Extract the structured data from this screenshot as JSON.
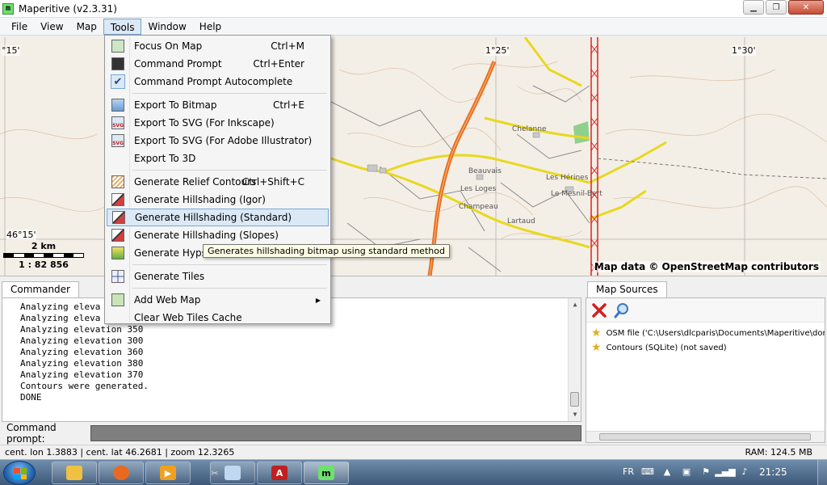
{
  "window": {
    "title": "Maperitive (v2.3.31)",
    "app_icon_letter": "m"
  },
  "menubar": {
    "items": [
      "File",
      "View",
      "Map",
      "Tools",
      "Window",
      "Help"
    ],
    "active": "Tools"
  },
  "map": {
    "coords": {
      "left_lon": "°15'",
      "mid_lon": "1°25'",
      "right_lon": "1°30'",
      "lat": "46°15'"
    },
    "scale_km": "2 km",
    "scale_ratio": "1 : 82 856",
    "attribution": "Map data © OpenStreetMap contributors",
    "place_names": [
      "Chelanne",
      "Les Hérines",
      "Le Mesnil-Bert",
      "Beauvais",
      "Champeau",
      "Les Loges",
      "Lartaud"
    ]
  },
  "tools_menu": {
    "items": [
      {
        "label": "Focus On Map",
        "shortcut": "Ctrl+M",
        "icon": "focus-map-icon"
      },
      {
        "label": "Command Prompt",
        "shortcut": "Ctrl+Enter",
        "icon": "command-prompt-icon"
      },
      {
        "label": "Command Prompt Autocomplete",
        "shortcut": "",
        "icon": "checkmark-icon"
      },
      {
        "label": "Export To Bitmap",
        "shortcut": "Ctrl+E",
        "icon": "export-bitmap-icon"
      },
      {
        "label": "Export To SVG (For Inkscape)",
        "shortcut": "",
        "icon": "svg-icon"
      },
      {
        "label": "Export To SVG (For Adobe Illustrator)",
        "shortcut": "",
        "icon": "svg-icon"
      },
      {
        "label": "Export To 3D",
        "shortcut": "",
        "icon": ""
      },
      {
        "label": "Generate Relief Contours",
        "shortcut": "Ctrl+Shift+C",
        "icon": "relief-contours-icon"
      },
      {
        "label": "Generate Hillshading (Igor)",
        "shortcut": "",
        "icon": "hillshading-icon"
      },
      {
        "label": "Generate Hillshading (Standard)",
        "shortcut": "",
        "icon": "hillshading-icon"
      },
      {
        "label": "Generate Hillshading (Slopes)",
        "shortcut": "",
        "icon": "hillshading-icon"
      },
      {
        "label": "Generate Hypso",
        "shortcut": "",
        "icon": "hypsometric-icon"
      },
      {
        "label": "Generate Tiles",
        "shortcut": "",
        "icon": "tiles-icon"
      },
      {
        "label": "Add Web Map",
        "shortcut": "",
        "icon": "add-web-map-icon"
      },
      {
        "label": "Clear Web Tiles Cache",
        "shortcut": "",
        "icon": ""
      }
    ],
    "highlighted": "Generate Hillshading (Standard)"
  },
  "tooltip": "Generates hillshading bitmap using standard method",
  "commander": {
    "tab_label": "Commander",
    "lines": [
      "Analyzing eleva",
      "Analyzing eleva",
      "Analyzing elevation 350",
      "Analyzing elevation 300",
      "Analyzing elevation 360",
      "Analyzing elevation 380",
      "Analyzing elevation 370",
      "Contours were generated.",
      "DONE"
    ],
    "prompt_label": "Command prompt:",
    "prompt_value": ""
  },
  "map_sources": {
    "tab_label": "Map Sources",
    "items": [
      "OSM file ('C:\\Users\\dlcparis\\Documents\\Maperitive\\donnees.c",
      "Contours (SQLite) (not saved)"
    ]
  },
  "status": {
    "position": "cent. lon 1.3883 | cent. lat 46.2681 | zoom 12.3265",
    "ram": "RAM: 124.5 MB"
  },
  "taskbar": {
    "language": "FR",
    "clock": "21:25"
  },
  "colors": {
    "highway": "#e8701e",
    "main_road": "#e8d820",
    "border_red": "#e02020",
    "forest": "#8fd08f",
    "menu_highlight": "#dbe8f6"
  }
}
